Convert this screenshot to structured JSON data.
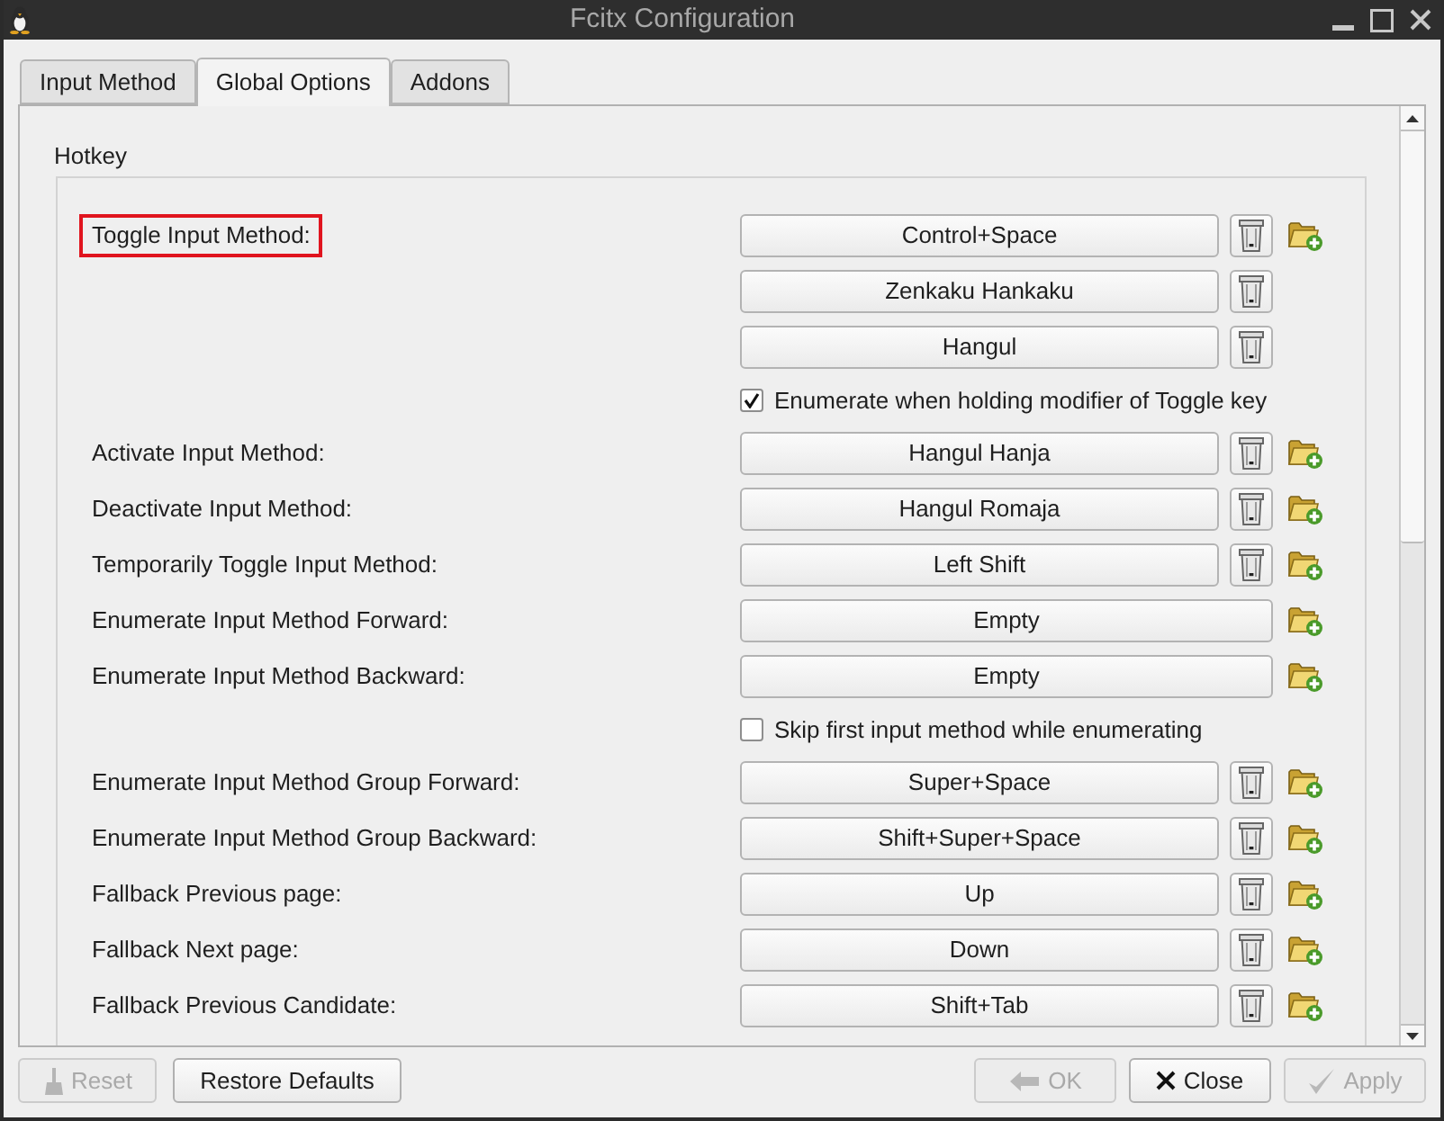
{
  "window": {
    "title": "Fcitx Configuration"
  },
  "tabs": [
    {
      "label": "Input Method",
      "selected": false
    },
    {
      "label": "Global Options",
      "selected": true
    },
    {
      "label": "Addons",
      "selected": false
    }
  ],
  "group": {
    "title": "Hotkey"
  },
  "rows": [
    {
      "kind": "key",
      "label": "Toggle Input Method:",
      "highlighted": true,
      "key": "Control+Space",
      "removable": true,
      "addable": true
    },
    {
      "kind": "key",
      "key": "Zenkaku Hankaku",
      "removable": true,
      "addable": false
    },
    {
      "kind": "key",
      "key": "Hangul",
      "removable": true,
      "addable": false
    },
    {
      "kind": "checkbox",
      "label": "Enumerate when holding modifier of Toggle key",
      "checked": true
    },
    {
      "kind": "key",
      "label": "Activate Input Method:",
      "highlighted": false,
      "key": "Hangul Hanja",
      "removable": true,
      "addable": true
    },
    {
      "kind": "key",
      "label": "Deactivate Input Method:",
      "highlighted": false,
      "key": "Hangul Romaja",
      "removable": true,
      "addable": true
    },
    {
      "kind": "key",
      "label": "Temporarily Toggle Input Method:",
      "highlighted": false,
      "key": "Left Shift",
      "removable": true,
      "addable": true
    },
    {
      "kind": "key",
      "label": "Enumerate Input Method Forward:",
      "highlighted": false,
      "key": "Empty",
      "removable": false,
      "addable": true
    },
    {
      "kind": "key",
      "label": "Enumerate Input Method Backward:",
      "highlighted": false,
      "key": "Empty",
      "removable": false,
      "addable": true
    },
    {
      "kind": "checkbox",
      "label": "Skip first input method while enumerating",
      "checked": false
    },
    {
      "kind": "key",
      "label": "Enumerate Input Method Group Forward:",
      "highlighted": false,
      "key": "Super+Space",
      "removable": true,
      "addable": true
    },
    {
      "kind": "key",
      "label": "Enumerate Input Method Group Backward:",
      "highlighted": false,
      "key": "Shift+Super+Space",
      "removable": true,
      "addable": true
    },
    {
      "kind": "key",
      "label": "Fallback Previous page:",
      "highlighted": false,
      "key": "Up",
      "removable": true,
      "addable": true
    },
    {
      "kind": "key",
      "label": "Fallback Next page:",
      "highlighted": false,
      "key": "Down",
      "removable": true,
      "addable": true
    },
    {
      "kind": "key",
      "label": "Fallback Previous Candidate:",
      "highlighted": false,
      "key": "Shift+Tab",
      "removable": true,
      "addable": true
    }
  ],
  "footer": {
    "left_buttons": [
      {
        "label": "Reset",
        "disabled": true
      },
      {
        "label": "Restore Defaults",
        "disabled": false
      }
    ],
    "right_buttons": [
      {
        "label": "OK",
        "disabled": true
      },
      {
        "label": "Close",
        "disabled": false
      },
      {
        "label": "Apply",
        "disabled": true
      }
    ]
  }
}
